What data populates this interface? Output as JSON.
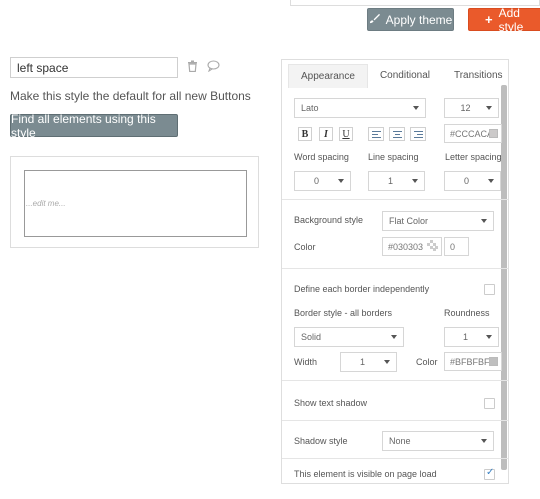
{
  "header": {
    "apply_theme": "Apply theme",
    "add_style": "Add style"
  },
  "style": {
    "name": "left space",
    "default_text": "Make this style the default for all new Buttons",
    "find_button": "Find all elements using this style",
    "preview_text": "...edit me..."
  },
  "panel": {
    "tabs": [
      "Appearance",
      "Conditional",
      "Transitions"
    ],
    "font": {
      "family": "Lato",
      "size": "12",
      "color": "#CCCACA",
      "color_swatch": "#CCCACA"
    },
    "formatting": {
      "bold": "B",
      "italic": "I",
      "underline": "U"
    },
    "spacing": {
      "word_label": "Word spacing",
      "line_label": "Line spacing",
      "letter_label": "Letter spacing",
      "word_value": "0",
      "line_value": "1",
      "letter_value": "0"
    },
    "background": {
      "style_label": "Background style",
      "style_value": "Flat Color",
      "color_label": "Color",
      "color_value": "#030303",
      "opacity_value": "0"
    },
    "border": {
      "independent_label": "Define each border independently",
      "style_label": "Border style - all borders",
      "roundness_label": "Roundness",
      "style_value": "Solid",
      "roundness_value": "1",
      "width_label": "Width",
      "width_value": "1",
      "color_label": "Color",
      "color_value": "#BFBFBF",
      "color_swatch": "#BFBFBF"
    },
    "shadow": {
      "text_shadow_label": "Show text shadow",
      "style_label": "Shadow style",
      "style_value": "None"
    },
    "visibility": {
      "label": "This element is visible on page load",
      "checked": true
    }
  },
  "colors": {
    "apply_button": "#7b8b91",
    "add_button": "#ea5a2b"
  }
}
